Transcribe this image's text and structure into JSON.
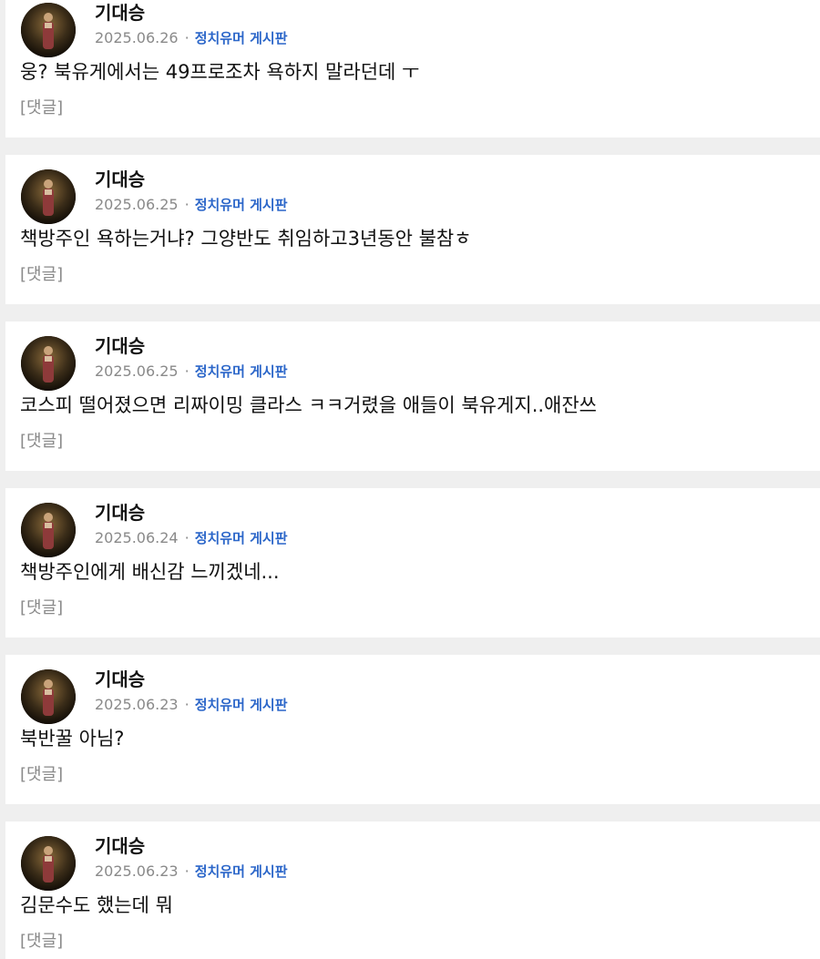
{
  "comments": [
    {
      "author": "기대승",
      "date": "2025.06.26",
      "separator": "·",
      "board": "정치유머 게시판",
      "content": "웅? 북유게에서는 49프로조차 욕하지 말라던데 ㅜ",
      "reply_label": "[댓글]"
    },
    {
      "author": "기대승",
      "date": "2025.06.25",
      "separator": "·",
      "board": "정치유머 게시판",
      "content": "책방주인 욕하는거냐? 그양반도 취임하고3년동안 불참ㅎ",
      "reply_label": "[댓글]"
    },
    {
      "author": "기대승",
      "date": "2025.06.25",
      "separator": "·",
      "board": "정치유머 게시판",
      "content": "코스피 떨어졌으면 리짜이밍 클라스 ㅋㅋ거렸을 애들이 북유게지..애잔쓰",
      "reply_label": "[댓글]"
    },
    {
      "author": "기대승",
      "date": "2025.06.24",
      "separator": "·",
      "board": "정치유머 게시판",
      "content": "책방주인에게 배신감 느끼겠네...",
      "reply_label": "[댓글]"
    },
    {
      "author": "기대승",
      "date": "2025.06.23",
      "separator": "·",
      "board": "정치유머 게시판",
      "content": "북반꿀 아님?",
      "reply_label": "[댓글]"
    },
    {
      "author": "기대승",
      "date": "2025.06.23",
      "separator": "·",
      "board": "정치유머 게시판",
      "content": "김문수도 했는데 뭐",
      "reply_label": "[댓글]"
    }
  ],
  "colors": {
    "background": "#efefef",
    "card": "#ffffff",
    "board_link": "#2b66c9",
    "muted": "#8a8a8a",
    "text": "#111111"
  },
  "icons": {
    "avatar": "user-profile-photo"
  }
}
